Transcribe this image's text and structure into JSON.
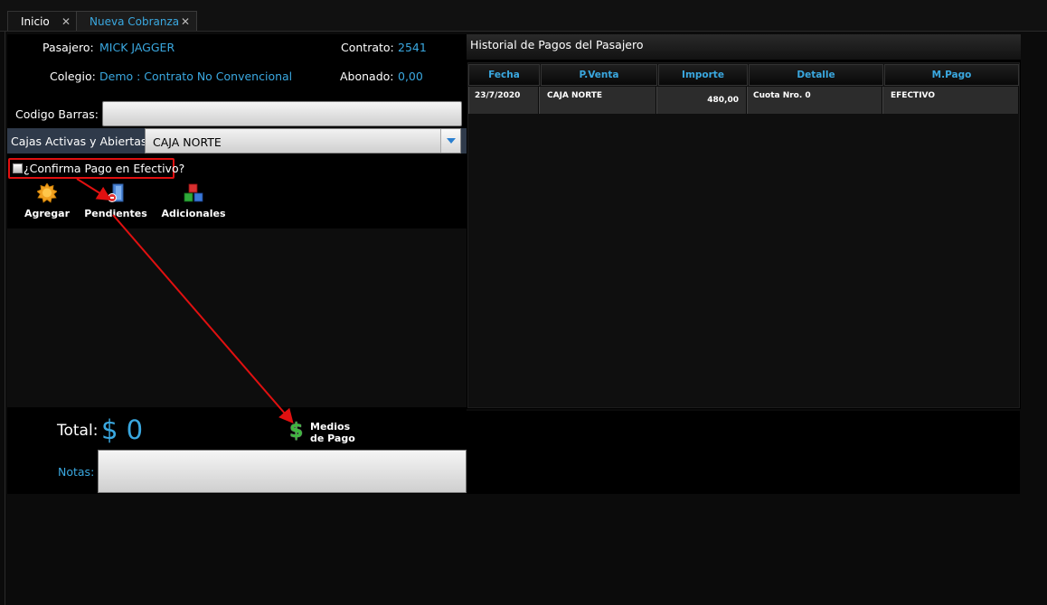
{
  "tabs": [
    {
      "label": "Inicio",
      "close": "✕"
    },
    {
      "label": "Nueva Cobranza",
      "close": "✕"
    }
  ],
  "form": {
    "pasajero_label": "Pasajero:",
    "pasajero_value": "MICK JAGGER",
    "contrato_label": "Contrato:",
    "contrato_value": "2541",
    "colegio_label": "Colegio:",
    "colegio_value": "Demo : Contrato No Convencional",
    "abonado_label": "Abonado:",
    "abonado_value": "0,00",
    "codigo_label": "Codigo Barras:",
    "codigo_value": "",
    "cajas_label": "Cajas Activas y Abiertas:",
    "cajas_selected": "CAJA NORTE",
    "confirma_label": "¿Confirma Pago en Efectivo?"
  },
  "toolbar": {
    "agregar": "Agregar",
    "pendientes": "Pendientes",
    "adicionales": "Adicionales"
  },
  "footer": {
    "total_label": "Total:",
    "total_value": "$ 0",
    "medios_line1": "Medios",
    "medios_line2": "de Pago",
    "notas_label": "Notas:"
  },
  "historial": {
    "title": "Historial de Pagos del Pasajero",
    "columns": [
      "Fecha",
      "P.Venta",
      "Importe",
      "Detalle",
      "M.Pago"
    ],
    "rows": [
      [
        "23/7/2020",
        "CAJA NORTE",
        "480,00",
        "Cuota Nro. 0",
        "EFECTIVO"
      ]
    ]
  },
  "colors": {
    "accent": "#3aa8e0",
    "highlight": "#e01010"
  }
}
